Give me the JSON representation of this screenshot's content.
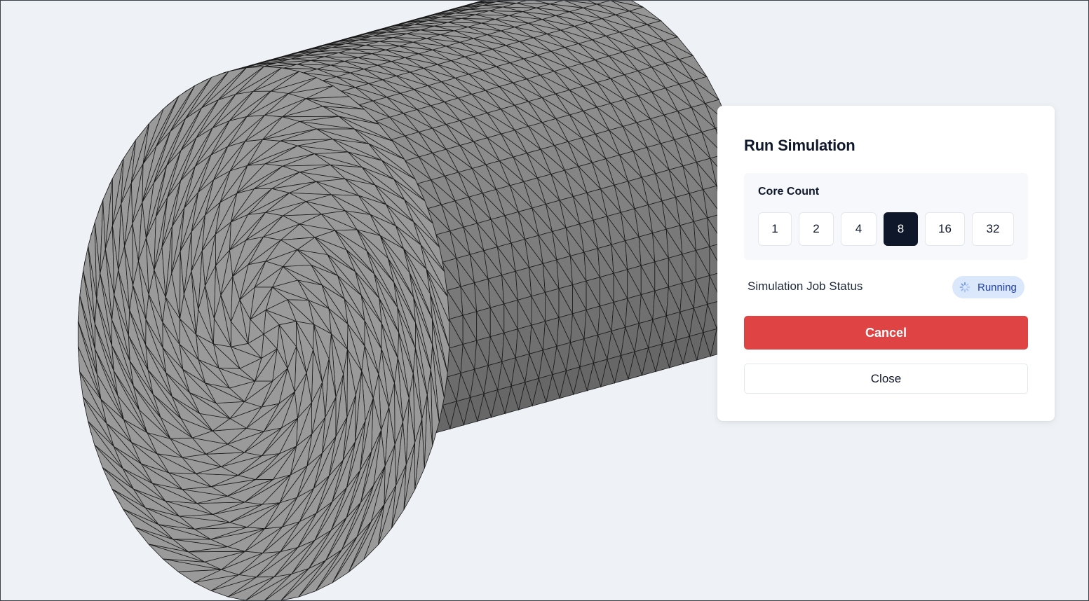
{
  "viewport": {
    "object": "cylinder-mesh",
    "colors": {
      "cap": "#9a9a9a",
      "side": "#6e6e6e",
      "edge": "#1a1a1a",
      "background": "#eef2f6"
    }
  },
  "dialog": {
    "title": "Run Simulation",
    "core_count": {
      "label": "Core Count",
      "options": [
        "1",
        "2",
        "4",
        "8",
        "16",
        "32"
      ],
      "selected": "8"
    },
    "status": {
      "label": "Simulation Job Status",
      "value": "Running",
      "icon": "spinner-icon"
    },
    "cancel_label": "Cancel",
    "close_label": "Close",
    "colors": {
      "cancel": "#e04343",
      "selected": "#0f172a",
      "badge_bg": "#dbe7fb",
      "badge_text": "#1e40af"
    }
  }
}
